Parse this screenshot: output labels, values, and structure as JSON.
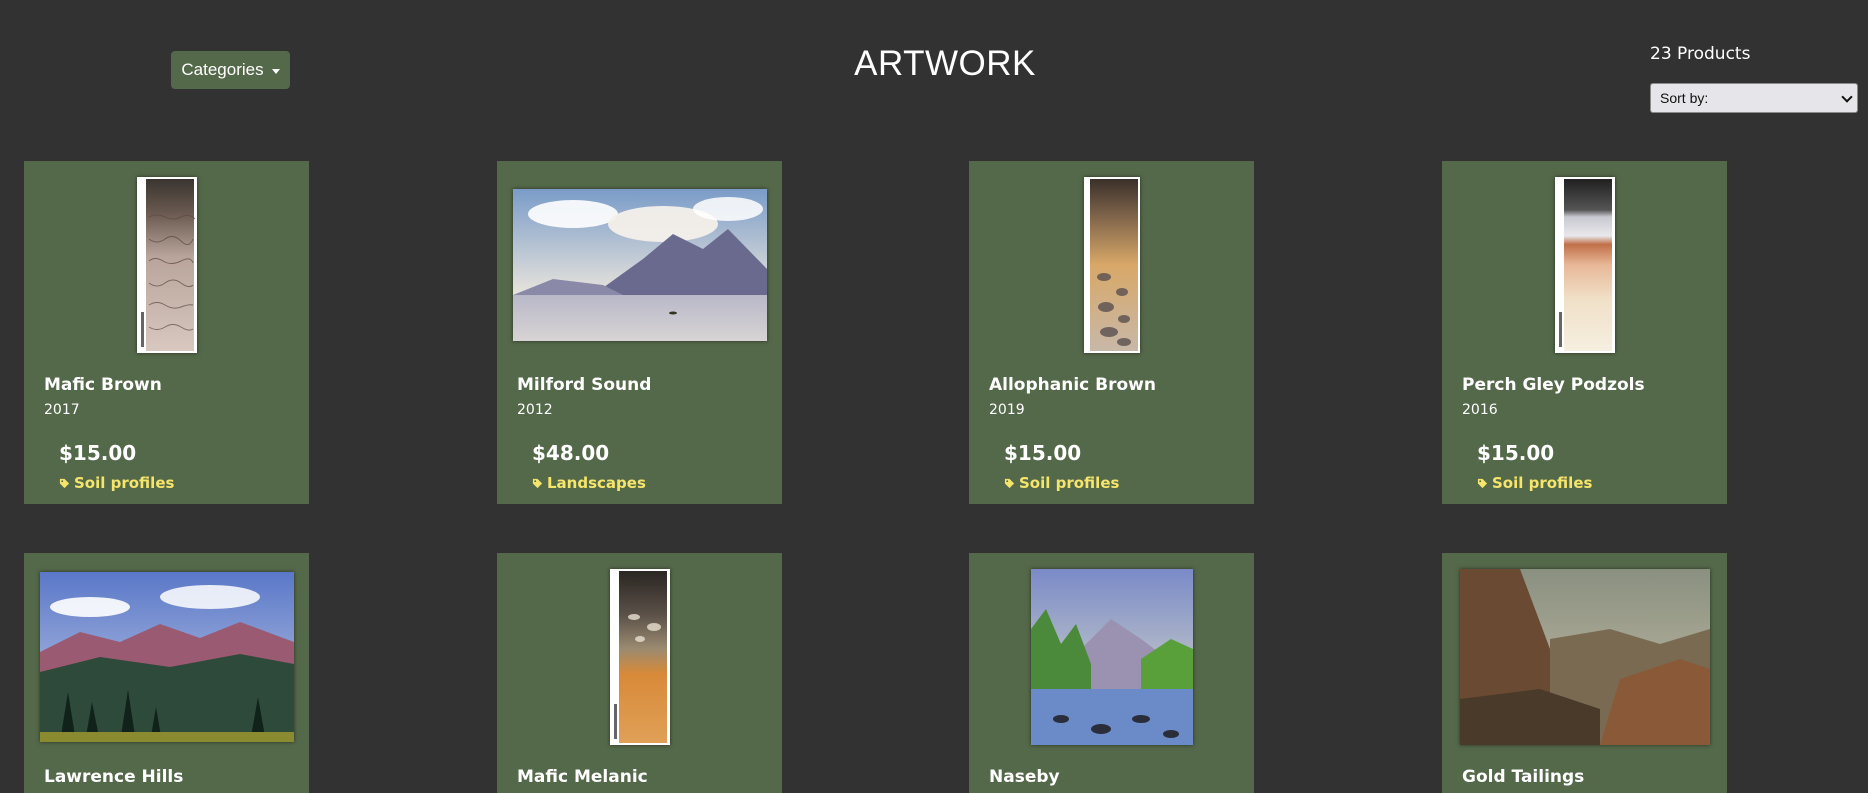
{
  "header": {
    "categories_label": "Categories",
    "title": "ARTWORK",
    "product_count": "23 Products",
    "sort_label": "Sort by:"
  },
  "products": [
    {
      "name": "Mafic Brown",
      "year": "2017",
      "price": "$15.00",
      "category": "Soil profiles",
      "image": "soil-profile"
    },
    {
      "name": "Milford Sound",
      "year": "2012",
      "price": "$48.00",
      "category": "Landscapes",
      "image": "landscape"
    },
    {
      "name": "Allophanic Brown",
      "year": "2019",
      "price": "$15.00",
      "category": "Soil profiles",
      "image": "soil-profile"
    },
    {
      "name": "Perch Gley Podzols",
      "year": "2016",
      "price": "$15.00",
      "category": "Soil profiles",
      "image": "soil-profile"
    },
    {
      "name": "Lawrence Hills",
      "image": "landscape"
    },
    {
      "name": "Mafic Melanic",
      "image": "soil-profile"
    },
    {
      "name": "Naseby",
      "image": "landscape"
    },
    {
      "name": "Gold Tailings",
      "image": "landscape"
    }
  ],
  "icons": {
    "tag": "tag-icon",
    "caret": "caret-down-icon"
  },
  "colors": {
    "background": "#323232",
    "card": "#54684a",
    "category_text": "#f5e56b"
  }
}
